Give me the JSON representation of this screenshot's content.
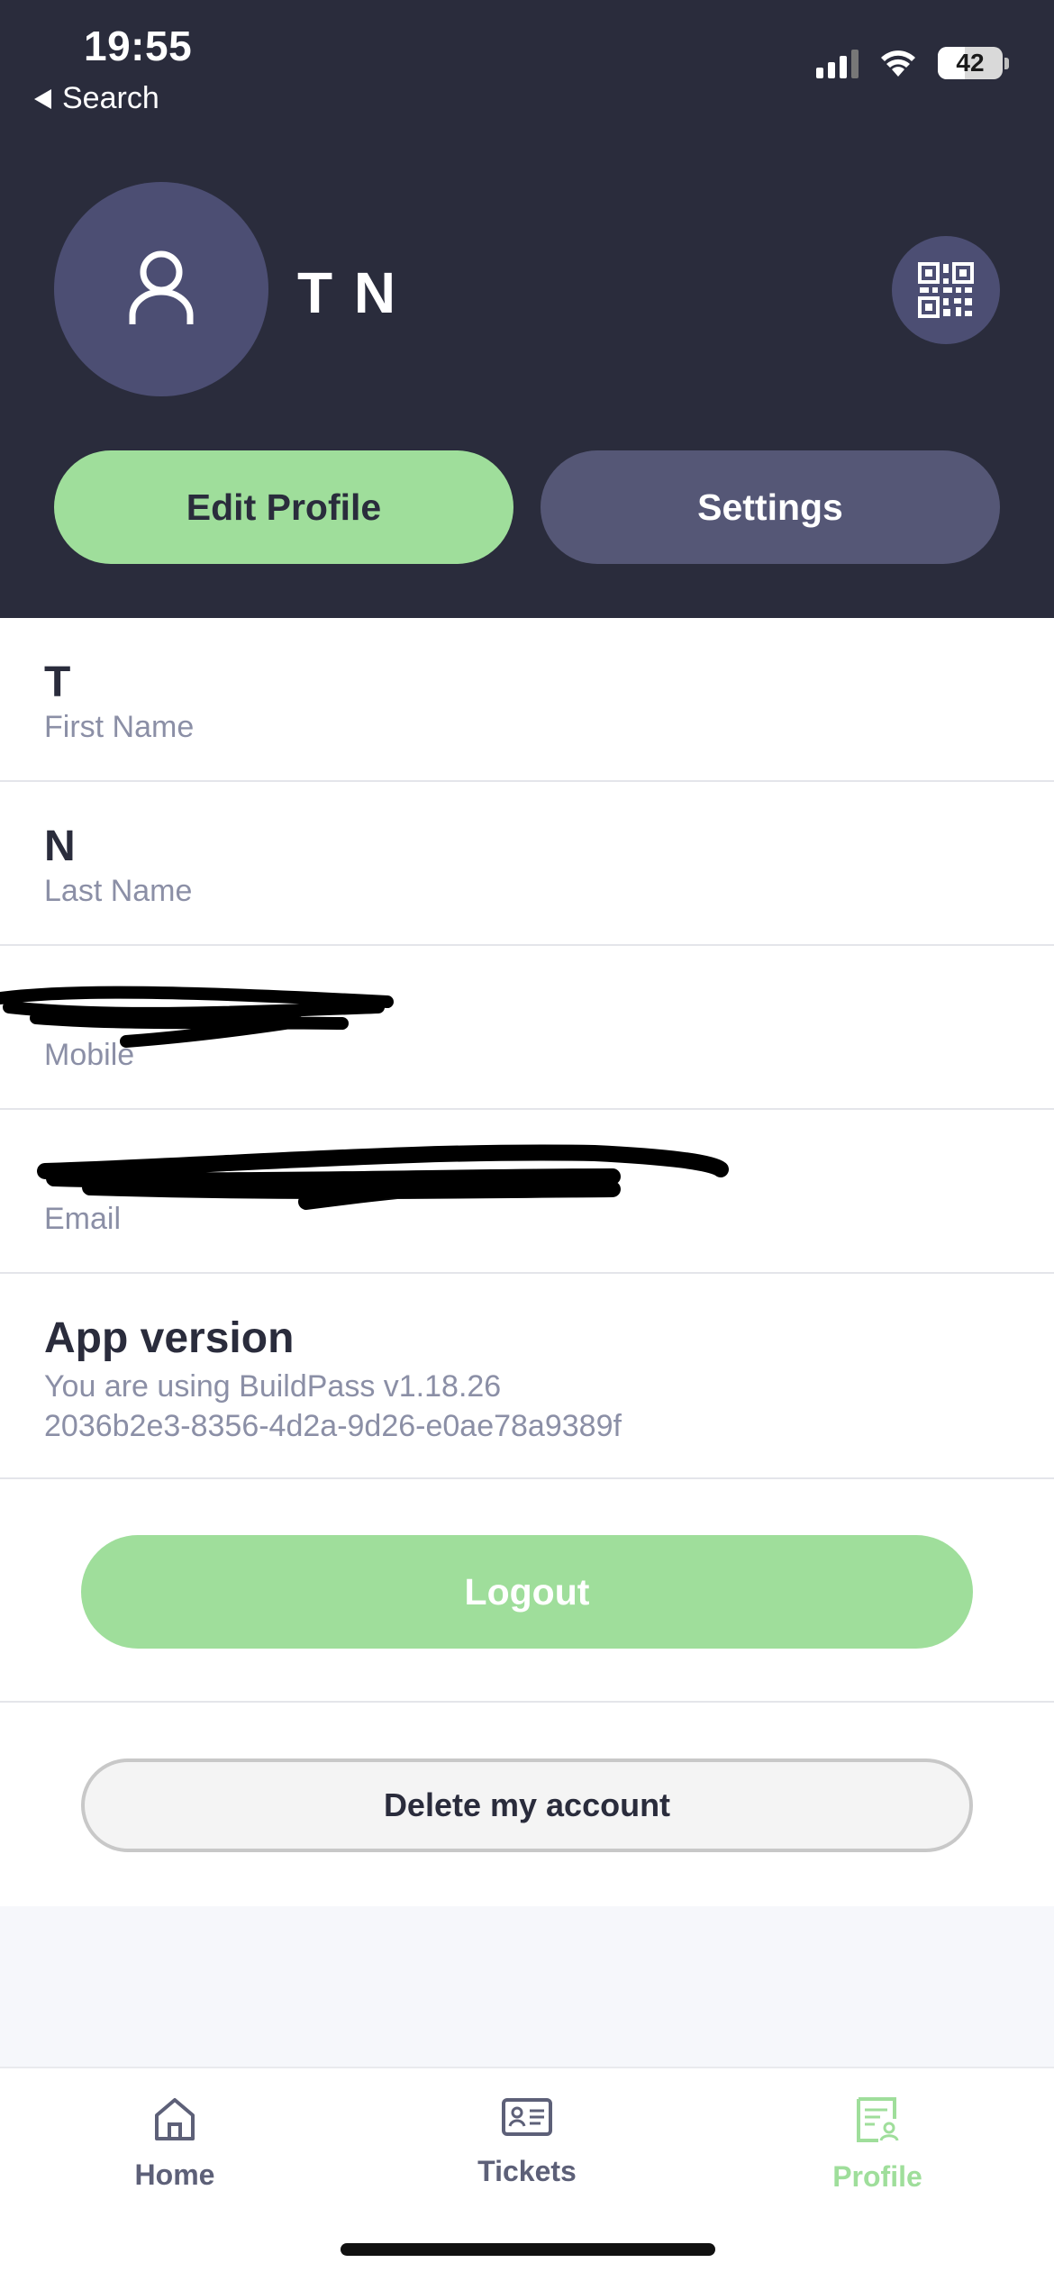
{
  "status_bar": {
    "time": "19:55",
    "back_label": "Search",
    "battery": "42",
    "battery_level": 0.42
  },
  "profile": {
    "display_name": "T N",
    "edit_label": "Edit Profile",
    "settings_label": "Settings"
  },
  "fields": {
    "first_name": {
      "value": "T",
      "label": "First Name"
    },
    "last_name": {
      "value": "N",
      "label": "Last Name"
    },
    "mobile": {
      "value": "",
      "label": "Mobile"
    },
    "email": {
      "value": "",
      "label": "Email"
    }
  },
  "app_version": {
    "title": "App version",
    "line1": "You are using BuildPass v1.18.26",
    "line2": "2036b2e3-8356-4d2a-9d26-e0ae78a9389f"
  },
  "actions": {
    "logout_label": "Logout",
    "delete_label": "Delete my account"
  },
  "tabbar": {
    "home": "Home",
    "tickets": "Tickets",
    "profile": "Profile",
    "active": "Profile"
  },
  "colors": {
    "header_bg": "#2a2c3c",
    "accent_green": "#9fde9b",
    "avatar_bg": "#4c4e73",
    "muted_text": "#8b8fa6"
  }
}
